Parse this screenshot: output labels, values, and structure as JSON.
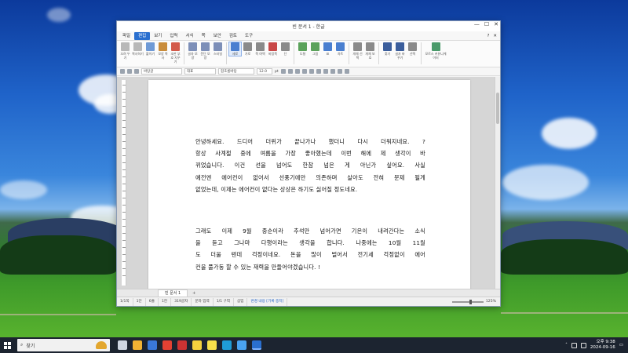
{
  "window": {
    "title": "빈 문서 1 - 한글",
    "controls": [
      "—",
      "☐",
      "✕"
    ]
  },
  "menubar": {
    "items": [
      "파일",
      "편집",
      "보기",
      "입력",
      "서식",
      "쪽",
      "보안",
      "검토",
      "도구"
    ],
    "active": "편집",
    "right_items": [
      "?",
      "✕"
    ]
  },
  "ribbon": {
    "buttons": [
      {
        "label": "오려 두기",
        "color": "#b8b8b8"
      },
      {
        "label": "복사하기",
        "color": "#b8b8b8"
      },
      {
        "label": "붙이기",
        "color": "#6f9ad6"
      },
      {
        "label": "모양 복사",
        "color": "#c98c3a"
      },
      {
        "label": "조판 부호 지우기",
        "color": "#d35a4a"
      },
      {
        "label": "글자 모양",
        "color": "#7d8fb8"
      },
      {
        "label": "문단 모양",
        "color": "#7d8fb8"
      },
      {
        "label": "스타일",
        "color": "#7d8fb8"
      },
      {
        "label": "세로",
        "color": "#4a7fd0"
      },
      {
        "label": "가로",
        "color": "#8a8a8a"
      },
      {
        "label": "쪽 여백",
        "color": "#8a8a8a"
      },
      {
        "label": "바탕쪽",
        "color": "#c94848"
      },
      {
        "label": "단",
        "color": "#8a8a8a"
      },
      {
        "label": "도형",
        "color": "#5ba25b"
      },
      {
        "label": "그림",
        "color": "#5ba25b"
      },
      {
        "label": "표",
        "color": "#4a7fd0"
      },
      {
        "label": "차트",
        "color": "#4a7fd0"
      },
      {
        "label": "개체 선택",
        "color": "#8a8a8a"
      },
      {
        "label": "개체 보호",
        "color": "#8a8a8a"
      },
      {
        "label": "찾기",
        "color": "#3b5e9c"
      },
      {
        "label": "글자 바꾸기",
        "color": "#3b5e9c"
      },
      {
        "label": "선택",
        "color": "#8a8a8a"
      },
      {
        "label": "모르스 커뮤니케이터",
        "color": "#4a9a6a"
      }
    ]
  },
  "fmtbar": {
    "style": "바탕글",
    "lang": "대표",
    "font": "함초롬바탕",
    "size": "12.0",
    "unit": "pt"
  },
  "document": {
    "paragraph1": [
      "안녕하세요.   드디어  더위가  끝나가나  했더니  다시  더워지네요.  ?",
      "항상  사계절  중에  여름을  가장  좋아했는데  이번  해에  제  생각이  바",
      "뀌었습니다.   이건  선을  넘어도  한참  넘은  게  아닌가  싶어요.   사실",
      "예전엔  에어컨이  없어서  선풍기에만  의존하며  살아도  전혀  문제  될게",
      "없었는데,  이제는  에어컨이  없다는  상상은  하기도  싫어질  정도네요."
    ],
    "paragraph2": [
      "그래도  이제  9월  중순이라  추석만  넘어가면  기온이  내려간다는  소식",
      "을  듣고  그나마  다행이라는  생각을  합니다.   나중에는  10월  11월",
      "도  더울  텐데  걱정이네요.  돈을  많이  벌어서  전기세  걱정없이  에어",
      "컨을  풀가동  할  수  있는  재력을  만들어야겠습니다.  !"
    ]
  },
  "tabs": {
    "doc_tab": "빈 문서 1",
    "add": "+"
  },
  "status": {
    "page": "1/1쪽",
    "section": "1단",
    "line": "6줄",
    "col": "1칸",
    "chars": "319글자",
    "mode": "문자 입력",
    "zone": "1/1 구역",
    "insert": "삽입",
    "change": "변경 내용 [기록 중지]",
    "zoom": "125%"
  },
  "taskbar": {
    "search_placeholder": "찾기",
    "time": "오후 9:38",
    "date": "2024-09-16",
    "icons": [
      {
        "name": "task-view-icon",
        "color": "#cfd6e2"
      },
      {
        "name": "app-icon-1",
        "color": "#f2b233"
      },
      {
        "name": "photos-icon",
        "color": "#3a78d8"
      },
      {
        "name": "chrome-icon",
        "color": "#e34133"
      },
      {
        "name": "record-icon",
        "color": "#c33"
      },
      {
        "name": "chat-icon",
        "color": "#f4d23e"
      },
      {
        "name": "kakao-icon",
        "color": "#f6e04b"
      },
      {
        "name": "edge-icon",
        "color": "#1f9cd6"
      },
      {
        "name": "store-icon",
        "color": "#4aa3f0"
      },
      {
        "name": "hwp-icon",
        "color": "#2a6fcf"
      }
    ]
  }
}
